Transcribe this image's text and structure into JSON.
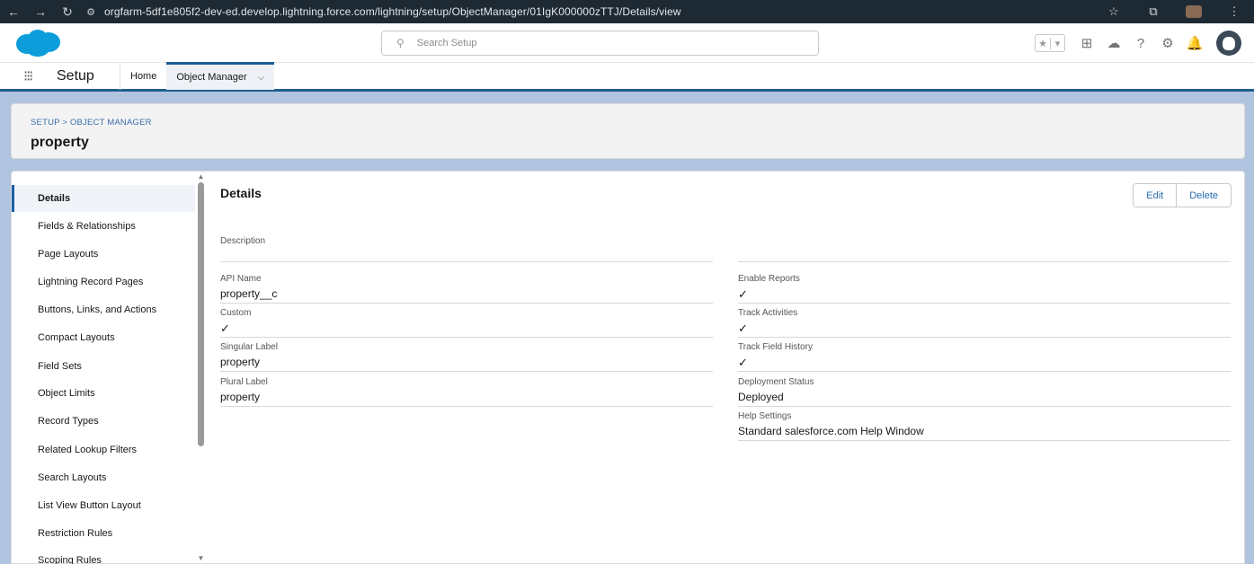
{
  "browser": {
    "back_icon": "←",
    "forward_icon": "→",
    "reload_icon": "↻",
    "site_info_icon": "⚙",
    "url": "orgfarm-5df1e805f2-dev-ed.develop.lightning.force.com/lightning/setup/ObjectManager/01IgK000000zTTJ/Details/view",
    "bookmark_icon": "☆",
    "extensions_icon": "⧉",
    "menu_icon": "⋮"
  },
  "header": {
    "search_placeholder": "Search Setup",
    "search_icon": "⚲",
    "favorites_star": "★",
    "favorites_dropdown": "▾",
    "add_icon": "⊞",
    "trailhead_icon": "☁",
    "help_icon": "?",
    "settings_icon": "⚙",
    "notifications_icon": "🔔"
  },
  "nav": {
    "launcher_icon": "⁝⁝⁝",
    "app_name": "Setup",
    "tabs": [
      {
        "label": "Home"
      },
      {
        "label": "Object Manager",
        "chevron": "⌵"
      }
    ]
  },
  "page_header": {
    "breadcrumb": "SETUP > OBJECT MANAGER",
    "title": "property"
  },
  "sidebar": {
    "items": [
      {
        "label": "Details"
      },
      {
        "label": "Fields & Relationships"
      },
      {
        "label": "Page Layouts"
      },
      {
        "label": "Lightning Record Pages"
      },
      {
        "label": "Buttons, Links, and Actions"
      },
      {
        "label": "Compact Layouts"
      },
      {
        "label": "Field Sets"
      },
      {
        "label": "Object Limits"
      },
      {
        "label": "Record Types"
      },
      {
        "label": "Related Lookup Filters"
      },
      {
        "label": "Search Layouts"
      },
      {
        "label": "List View Button Layout"
      },
      {
        "label": "Restriction Rules"
      },
      {
        "label": "Scoping Rules"
      }
    ],
    "scroll_up": "▲",
    "scroll_down": "▼"
  },
  "details": {
    "title": "Details",
    "edit_label": "Edit",
    "delete_label": "Delete",
    "description_label": "Description",
    "api_name_label": "API Name",
    "api_name_value": "property__c",
    "custom_label": "Custom",
    "custom_check": "✓",
    "singular_label_label": "Singular Label",
    "singular_label_value": "property",
    "plural_label_label": "Plural Label",
    "plural_label_value": "property",
    "enable_reports_label": "Enable Reports",
    "enable_reports_check": "✓",
    "track_activities_label": "Track Activities",
    "track_activities_check": "✓",
    "track_field_history_label": "Track Field History",
    "track_field_history_check": "✓",
    "deployment_status_label": "Deployment Status",
    "deployment_status_value": "Deployed",
    "help_settings_label": "Help Settings",
    "help_settings_value": "Standard salesforce.com Help Window"
  },
  "colors": {
    "brand": "#0d9dda",
    "link": "#2a6cb0",
    "nav_accent": "#1b5c96"
  }
}
